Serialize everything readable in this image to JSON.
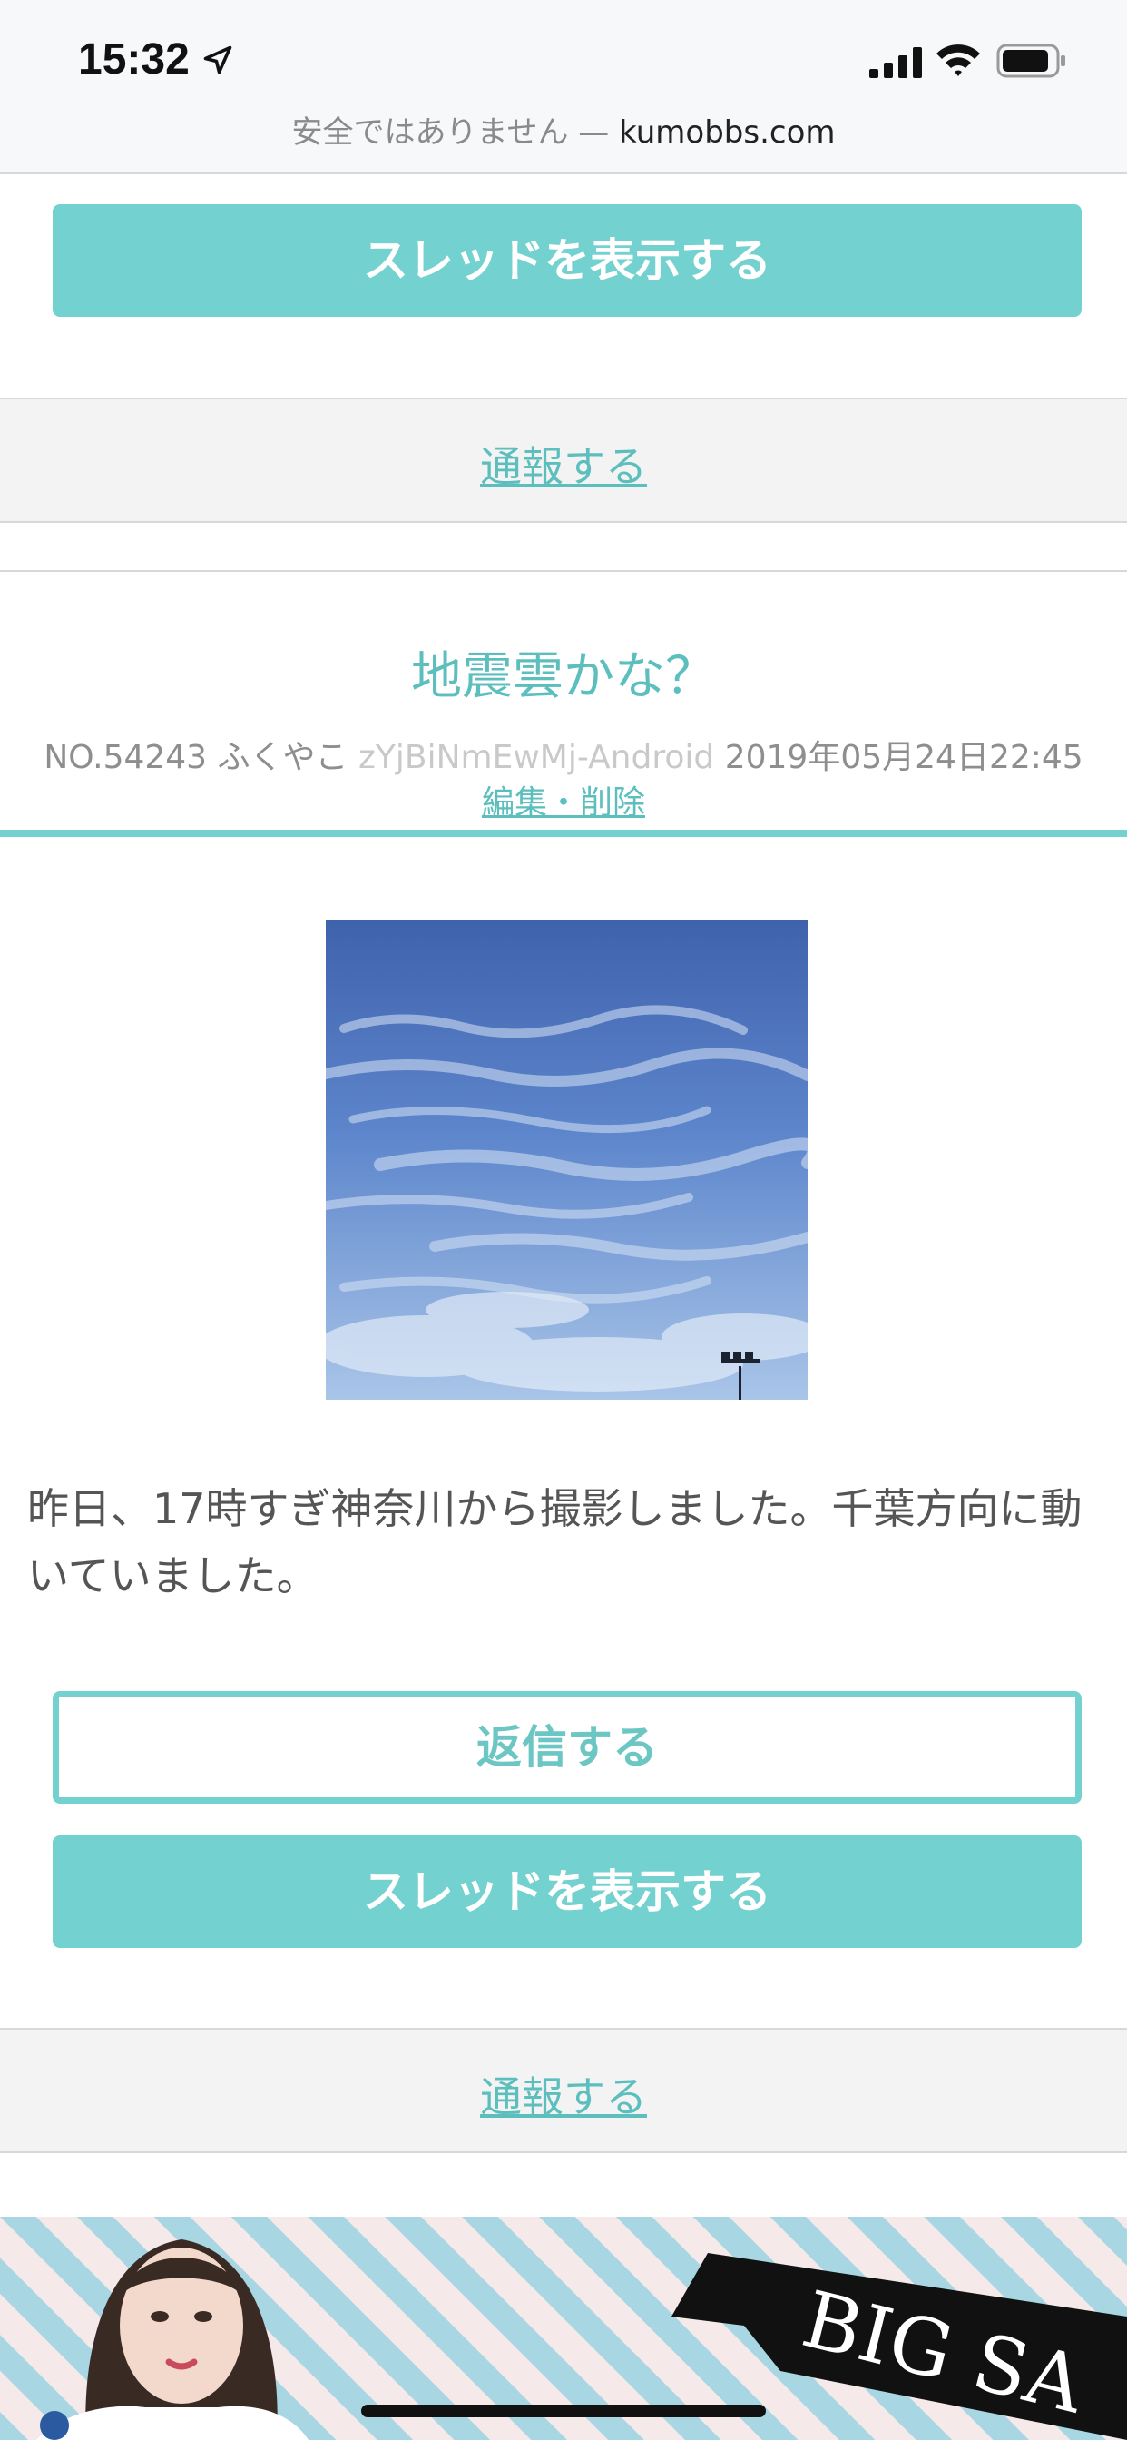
{
  "status_bar": {
    "time": "15:32",
    "icons": [
      "location-arrow-icon",
      "signal-bars-icon",
      "wifi-icon",
      "battery-icon"
    ]
  },
  "address_bar": {
    "security_text": "安全ではありません — ",
    "domain": "kumobbs.com"
  },
  "previous_post": {
    "show_thread_label": "スレッドを表示する",
    "report_label": "通報する"
  },
  "post": {
    "title": "地震雲かな？",
    "number": "NO.54243",
    "author": "ふくやこ",
    "user_id": "zYjBiNmEwMj-Android",
    "datetime": "2019年05月24日22:45",
    "edit_delete_label": "編集・削除",
    "body": "昨日、17時すぎ神奈川から撮影しました。千葉方向に動いていました。",
    "reply_label": "返信する",
    "show_thread_label": "スレッドを表示する",
    "report_label": "通報する"
  },
  "ad_banner": {
    "text": "BIG SA"
  },
  "colors": {
    "accent": "#73d1cf",
    "link": "#5cbfbd",
    "band": "#f3f3f3"
  }
}
